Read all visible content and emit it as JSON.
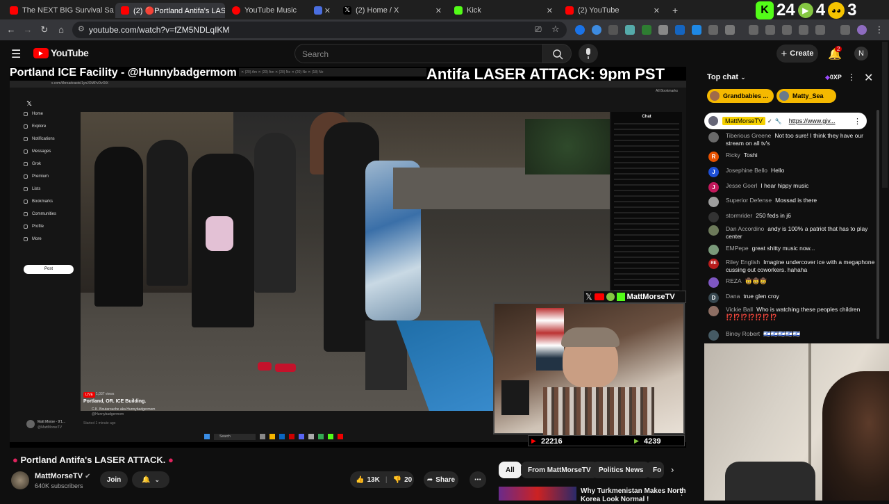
{
  "browser": {
    "tabs": [
      {
        "label": "The NEXT BIG Survival Sandbo",
        "color": "#ff0000"
      },
      {
        "label": "(2) 🔴Portland Antifa's LAS",
        "color": "#ff0000",
        "active": true
      },
      {
        "label": "YouTube Music",
        "color": "#ff0000"
      },
      {
        "label": "",
        "color": "#4a6ee0"
      },
      {
        "label": "(2) Home / X",
        "color": "#ffffff"
      },
      {
        "label": "Kick",
        "color": "#53fc18"
      },
      {
        "label": "(2) YouTube",
        "color": "#ff0000"
      }
    ],
    "new_tab": "+",
    "url": "youtube.com/watch?v=fZM5NDLqIKM",
    "overlay_counts": {
      "kick": "24",
      "rumble": "4",
      "other": "3"
    }
  },
  "youtube": {
    "logo_text": "YouTube",
    "search_placeholder": "Search",
    "create_label": "Create",
    "notif_count": "2",
    "avatar_initial": "N"
  },
  "video": {
    "title_left": "Portland ICE Facility - @Hunnybadgermom",
    "title_right": "Antifa LASER ATTACK: 9pm PST",
    "inner": {
      "url": "x.com/i/broadcasts/1ynJOMPvDvOlX",
      "bookmarks": "All Bookmarks",
      "sidebar": [
        "Home",
        "Explore",
        "Notifications",
        "Messages",
        "Grok",
        "Premium",
        "Lists",
        "Bookmarks",
        "Communities",
        "Profile",
        "More"
      ],
      "post_label": "Post",
      "chat_title": "Chat",
      "caption": "Portland, OR. ICE Building.",
      "caption_user": "C.K. Boutarouche aka Hunnybadgermom",
      "caption_handle": "@Hunnybadgermom",
      "caption_time": "Started 1 minute ago",
      "live_badge": "LIVE",
      "viewers": "1,037 views",
      "bottom_user": "Matt Morse - 9'1...",
      "bottom_handle": "@MattMorseTV",
      "taskbar_search": "Search"
    },
    "cam_name": "MattMorseTV",
    "yt_count": "22216",
    "rumble_count": "4239"
  },
  "below": {
    "title": "Portland Antifa's LASER ATTACK.",
    "channel": "MattMorseTV",
    "subs": "640K subscribers",
    "join": "Join",
    "likes": "13K",
    "dislikes": "20",
    "share": "Share"
  },
  "chips": [
    "All",
    "From MattMorseTV",
    "Politics News",
    "Fo"
  ],
  "rec": {
    "title_line1": "Why Turkmenistan Makes North",
    "title_line2": "Korea Look Normal !"
  },
  "chat": {
    "header": "Top chat",
    "points": "0XP",
    "pinned": [
      {
        "name": "Grandbabies ..."
      },
      {
        "name": "Matty_Sea"
      }
    ],
    "highlight_name": "MattMorseTV",
    "highlight_link": "https://www.giv...",
    "messages": [
      {
        "name": "Tiberious Greene",
        "text": "Not too sure! I think they have our stream on all tv's",
        "color": "#6a6a6a",
        "initial": ""
      },
      {
        "name": "Ricky",
        "text": "Toshi",
        "color": "#e65100",
        "initial": "R"
      },
      {
        "name": "Josephine Bello",
        "text": "Hello",
        "color": "#1e4fd6",
        "initial": "J"
      },
      {
        "name": "Jesse Goerl",
        "text": "I hear hippy music",
        "color": "#c2185b",
        "initial": "J"
      },
      {
        "name": "Superior Defense",
        "text": "Mossad is there",
        "color": "#9e9e9e",
        "initial": ""
      },
      {
        "name": "stormrider",
        "text": "250 feds in j6",
        "color": "#333",
        "initial": ""
      },
      {
        "name": "Dan Accordino",
        "text": "andy is 100% a patriot that has to play center",
        "color": "#6d7a5a",
        "initial": ""
      },
      {
        "name": "EMPepe",
        "text": "great shitty music now...",
        "color": "#7a9a7a",
        "initial": ""
      },
      {
        "name": "Riley English",
        "text": "Imagine undercover ice with a megaphone cussing out coworkers. hahaha",
        "color": "#b71c1c",
        "initial": "RE"
      },
      {
        "name": "REZA",
        "text": "🤠🤠🤠",
        "color": "#7e57c2",
        "initial": ""
      },
      {
        "name": "Dana",
        "text": "true glen croy",
        "color": "#37474f",
        "initial": "D"
      },
      {
        "name": "Vickie Ball",
        "text": "Who is watching these peoples children ⁉️⁉️⁉️⁉️⁉️⁉️⁉️",
        "color": "#8d6e63",
        "initial": ""
      },
      {
        "name": "Binoy Robert",
        "text": "🇮🇱🇮🇱🇮🇱🇮🇱🇮🇱",
        "color": "#455a64",
        "initial": ""
      }
    ]
  }
}
